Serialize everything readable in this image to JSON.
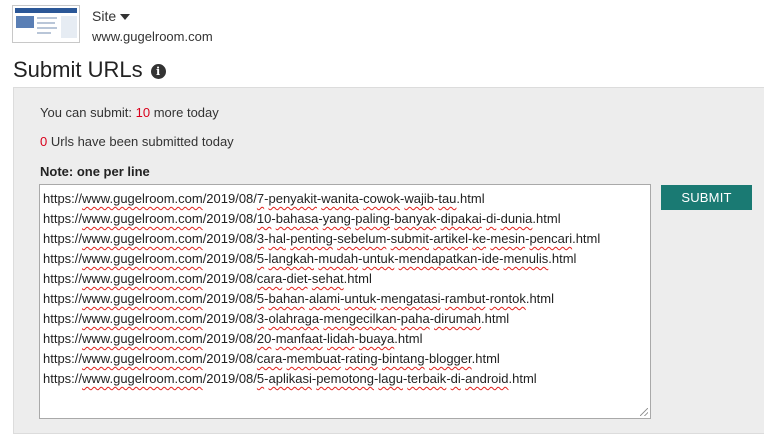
{
  "site": {
    "label": "Site",
    "url": "www.gugelroom.com"
  },
  "page_title": "Submit URLs",
  "quota": {
    "can_submit_prefix": "You can submit: ",
    "can_submit_count": "10",
    "can_submit_suffix": " more today",
    "submitted_count": "0",
    "submitted_suffix": " Urls have been submitted today"
  },
  "note_label": "Note: one per line",
  "submit_label": "SUBMIT",
  "urls": [
    {
      "prefix": "https://",
      "domain": "www.gugelroom.com",
      "path_pre": "/2019/08/",
      "slug": "7-penyakit-wanita-cowok-wajib-tau",
      "ext": ".html"
    },
    {
      "prefix": "https://",
      "domain": "www.gugelroom.com",
      "path_pre": "/2019/08/",
      "slug": "10-bahasa-yang-paling-banyak-dipakai-di-dunia",
      "ext": ".html"
    },
    {
      "prefix": "https://",
      "domain": "www.gugelroom.com",
      "path_pre": "/2019/08/",
      "slug": "3-hal-penting-sebelum-submit-artikel-ke-mesin-pencari",
      "ext": ".html"
    },
    {
      "prefix": "https://",
      "domain": "www.gugelroom.com",
      "path_pre": "/2019/08/",
      "slug": "5-langkah-mudah-untuk-mendapatkan-ide-menulis",
      "ext": ".html"
    },
    {
      "prefix": "https://",
      "domain": "www.gugelroom.com",
      "path_pre": "/2019/08/",
      "slug": "cara-diet-sehat",
      "ext": ".html"
    },
    {
      "prefix": "https://",
      "domain": "www.gugelroom.com",
      "path_pre": "/2019/08/",
      "slug": "5-bahan-alami-untuk-mengatasi-rambut-rontok",
      "ext": ".html"
    },
    {
      "prefix": "https://",
      "domain": "www.gugelroom.com",
      "path_pre": "/2019/08/",
      "slug": "3-olahraga-mengecilkan-paha-dirumah",
      "ext": ".html"
    },
    {
      "prefix": "https://",
      "domain": "www.gugelroom.com",
      "path_pre": "/2019/08/",
      "slug": "20-manfaat-lidah-buaya",
      "ext": ".html"
    },
    {
      "prefix": "https://",
      "domain": "www.gugelroom.com",
      "path_pre": "/2019/08/",
      "slug": "cara-membuat-rating-bintang-blogger",
      "ext": ".html"
    },
    {
      "prefix": "https://",
      "domain": "www.gugelroom.com",
      "path_pre": "/2019/08/",
      "slug": "5-aplikasi-pemotong-lagu-terbaik-di-android",
      "ext": ".html"
    }
  ],
  "colors": {
    "accent": "#1a7a73",
    "count_highlight": "#d9001b",
    "panel_bg": "#ededed"
  }
}
